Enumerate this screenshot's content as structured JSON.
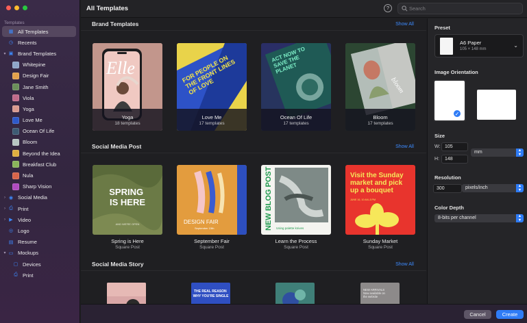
{
  "sidebar": {
    "section_label": "Templates",
    "items": [
      {
        "label": "All Templates",
        "icon": "grid-icon",
        "level": 0,
        "chev": "",
        "selected": true
      },
      {
        "label": "Recents",
        "icon": "clock-icon",
        "level": 0,
        "chev": ""
      },
      {
        "label": "Brand Templates",
        "icon": "brand-folder-icon",
        "level": 0,
        "chev": "▾"
      },
      {
        "label": "Whitepine",
        "icon": "whitepine-thumb",
        "level": 1,
        "color": "#8fa6c8"
      },
      {
        "label": "Design Fair",
        "icon": "design-fair-thumb",
        "level": 1,
        "color": "#e3a24c"
      },
      {
        "label": "Jane Smith",
        "icon": "jane-smith-thumb",
        "level": 1,
        "color": "#6b8f5a"
      },
      {
        "label": "Viola",
        "icon": "viola-thumb",
        "level": 1,
        "color": "#c06a8a"
      },
      {
        "label": "Yoga",
        "icon": "yoga-thumb",
        "level": 1,
        "color": "#d99a8f"
      },
      {
        "label": "Love Me",
        "icon": "love-me-thumb",
        "level": 1,
        "color": "#2e59c9"
      },
      {
        "label": "Ocean Of Life",
        "icon": "ocean-thumb",
        "level": 1,
        "color": "#3d5a73"
      },
      {
        "label": "Bloom",
        "icon": "bloom-thumb",
        "level": 1,
        "color": "#b7c6c2"
      },
      {
        "label": "Beyond the Idea",
        "icon": "beyond-thumb",
        "level": 1,
        "color": "#e0b040"
      },
      {
        "label": "Breakfast Club",
        "icon": "breakfast-thumb",
        "level": 1,
        "color": "#8ab45a"
      },
      {
        "label": "Nula",
        "icon": "nula-thumb",
        "level": 1,
        "color": "#d8654a"
      },
      {
        "label": "Sharp Vision",
        "icon": "sharp-vision-thumb",
        "level": 1,
        "color": "#b04ac0"
      },
      {
        "label": "Social Media",
        "icon": "social-media-icon",
        "level": 0,
        "chev": "›"
      },
      {
        "label": "Print",
        "icon": "print-icon",
        "level": 0,
        "chev": "›"
      },
      {
        "label": "Video",
        "icon": "video-icon",
        "level": 0,
        "chev": "›"
      },
      {
        "label": "Logo",
        "icon": "logo-icon",
        "level": 0,
        "chev": ""
      },
      {
        "label": "Resume",
        "icon": "resume-icon",
        "level": 0,
        "chev": ""
      },
      {
        "label": "Mockups",
        "icon": "mockups-icon",
        "level": 0,
        "chev": "▾"
      },
      {
        "label": "Devices",
        "icon": "devices-icon",
        "level": 1
      },
      {
        "label": "Print",
        "icon": "print-mockup-icon",
        "level": 1
      }
    ]
  },
  "header": {
    "title": "All Templates",
    "search_placeholder": "Search"
  },
  "sections": [
    {
      "title": "Brand Templates",
      "show_all": "Show All"
    },
    {
      "title": "Social Media Post",
      "show_all": "Show All"
    },
    {
      "title": "Social Media Story",
      "show_all": "Show All"
    }
  ],
  "brand_cards": [
    {
      "name": "Yoga",
      "count": "18 templates",
      "art": "Elle"
    },
    {
      "name": "Love Me",
      "count": "17 templates",
      "art": "FOR PEOPLE ON THE FRONT LINES OF LOVE"
    },
    {
      "name": "Ocean Of Life",
      "count": "17 templates",
      "art": "ACT NOW TO SAVE THE PLANET"
    },
    {
      "name": "Bloom",
      "count": "17 templates",
      "art": "bloom"
    }
  ],
  "post_cards": [
    {
      "name": "Spring is Here",
      "type": "Square Post",
      "art": "SPRING IS HERE",
      "art_small": "AND WE'RE OPEN"
    },
    {
      "name": "September Fair",
      "type": "Square Post",
      "art": "DESIGN FAIR",
      "art_small": "September 15th"
    },
    {
      "name": "Learn the Process",
      "type": "Square Post",
      "art": "NEW BLOG POST",
      "art_small": "Using palette knives"
    },
    {
      "name": "Sunday Market",
      "type": "Square Post",
      "art": "Visit the Sunday market and pick up a bouquet",
      "art_small": "JUNE 16, 10 AM–5 PM"
    }
  ],
  "story_cards": [
    {
      "art": ""
    },
    {
      "art": "THE REAL REASON WHY YOU'RE SINGLE"
    },
    {
      "art": ""
    },
    {
      "art": "NEW ARRIVALS Now available on the website"
    }
  ],
  "panel": {
    "preset_label": "Preset",
    "preset_name": "A6 Paper",
    "preset_size": "105 × 148 mm",
    "orientation_label": "Image Orientation",
    "size_label": "Size",
    "w_label": "W:",
    "w_value": "105",
    "h_label": "H:",
    "h_value": "148",
    "unit": "mm",
    "resolution_label": "Resolution",
    "resolution_value": "300",
    "resolution_unit": "pixels/inch",
    "color_depth_label": "Color Depth",
    "color_depth_value": "8-bits per channel"
  },
  "footer": {
    "cancel": "Cancel",
    "create": "Create"
  },
  "colors": {
    "accent": "#2f7cf6",
    "sidebar_bg": "#3a2b48"
  }
}
